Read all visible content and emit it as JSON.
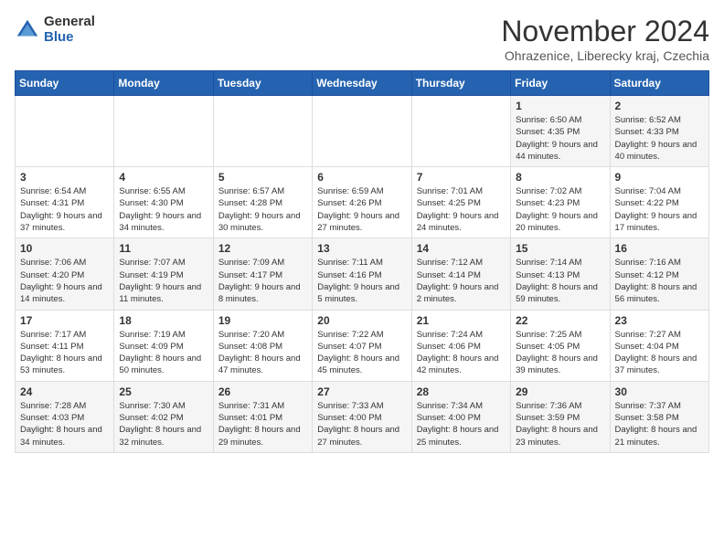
{
  "logo": {
    "general": "General",
    "blue": "Blue"
  },
  "title": "November 2024",
  "subtitle": "Ohrazenice, Liberecky kraj, Czechia",
  "weekdays": [
    "Sunday",
    "Monday",
    "Tuesday",
    "Wednesday",
    "Thursday",
    "Friday",
    "Saturday"
  ],
  "weeks": [
    [
      {
        "num": "",
        "info": ""
      },
      {
        "num": "",
        "info": ""
      },
      {
        "num": "",
        "info": ""
      },
      {
        "num": "",
        "info": ""
      },
      {
        "num": "",
        "info": ""
      },
      {
        "num": "1",
        "info": "Sunrise: 6:50 AM\nSunset: 4:35 PM\nDaylight: 9 hours\nand 44 minutes."
      },
      {
        "num": "2",
        "info": "Sunrise: 6:52 AM\nSunset: 4:33 PM\nDaylight: 9 hours\nand 40 minutes."
      }
    ],
    [
      {
        "num": "3",
        "info": "Sunrise: 6:54 AM\nSunset: 4:31 PM\nDaylight: 9 hours\nand 37 minutes."
      },
      {
        "num": "4",
        "info": "Sunrise: 6:55 AM\nSunset: 4:30 PM\nDaylight: 9 hours\nand 34 minutes."
      },
      {
        "num": "5",
        "info": "Sunrise: 6:57 AM\nSunset: 4:28 PM\nDaylight: 9 hours\nand 30 minutes."
      },
      {
        "num": "6",
        "info": "Sunrise: 6:59 AM\nSunset: 4:26 PM\nDaylight: 9 hours\nand 27 minutes."
      },
      {
        "num": "7",
        "info": "Sunrise: 7:01 AM\nSunset: 4:25 PM\nDaylight: 9 hours\nand 24 minutes."
      },
      {
        "num": "8",
        "info": "Sunrise: 7:02 AM\nSunset: 4:23 PM\nDaylight: 9 hours\nand 20 minutes."
      },
      {
        "num": "9",
        "info": "Sunrise: 7:04 AM\nSunset: 4:22 PM\nDaylight: 9 hours\nand 17 minutes."
      }
    ],
    [
      {
        "num": "10",
        "info": "Sunrise: 7:06 AM\nSunset: 4:20 PM\nDaylight: 9 hours\nand 14 minutes."
      },
      {
        "num": "11",
        "info": "Sunrise: 7:07 AM\nSunset: 4:19 PM\nDaylight: 9 hours\nand 11 minutes."
      },
      {
        "num": "12",
        "info": "Sunrise: 7:09 AM\nSunset: 4:17 PM\nDaylight: 9 hours\nand 8 minutes."
      },
      {
        "num": "13",
        "info": "Sunrise: 7:11 AM\nSunset: 4:16 PM\nDaylight: 9 hours\nand 5 minutes."
      },
      {
        "num": "14",
        "info": "Sunrise: 7:12 AM\nSunset: 4:14 PM\nDaylight: 9 hours\nand 2 minutes."
      },
      {
        "num": "15",
        "info": "Sunrise: 7:14 AM\nSunset: 4:13 PM\nDaylight: 8 hours\nand 59 minutes."
      },
      {
        "num": "16",
        "info": "Sunrise: 7:16 AM\nSunset: 4:12 PM\nDaylight: 8 hours\nand 56 minutes."
      }
    ],
    [
      {
        "num": "17",
        "info": "Sunrise: 7:17 AM\nSunset: 4:11 PM\nDaylight: 8 hours\nand 53 minutes."
      },
      {
        "num": "18",
        "info": "Sunrise: 7:19 AM\nSunset: 4:09 PM\nDaylight: 8 hours\nand 50 minutes."
      },
      {
        "num": "19",
        "info": "Sunrise: 7:20 AM\nSunset: 4:08 PM\nDaylight: 8 hours\nand 47 minutes."
      },
      {
        "num": "20",
        "info": "Sunrise: 7:22 AM\nSunset: 4:07 PM\nDaylight: 8 hours\nand 45 minutes."
      },
      {
        "num": "21",
        "info": "Sunrise: 7:24 AM\nSunset: 4:06 PM\nDaylight: 8 hours\nand 42 minutes."
      },
      {
        "num": "22",
        "info": "Sunrise: 7:25 AM\nSunset: 4:05 PM\nDaylight: 8 hours\nand 39 minutes."
      },
      {
        "num": "23",
        "info": "Sunrise: 7:27 AM\nSunset: 4:04 PM\nDaylight: 8 hours\nand 37 minutes."
      }
    ],
    [
      {
        "num": "24",
        "info": "Sunrise: 7:28 AM\nSunset: 4:03 PM\nDaylight: 8 hours\nand 34 minutes."
      },
      {
        "num": "25",
        "info": "Sunrise: 7:30 AM\nSunset: 4:02 PM\nDaylight: 8 hours\nand 32 minutes."
      },
      {
        "num": "26",
        "info": "Sunrise: 7:31 AM\nSunset: 4:01 PM\nDaylight: 8 hours\nand 29 minutes."
      },
      {
        "num": "27",
        "info": "Sunrise: 7:33 AM\nSunset: 4:00 PM\nDaylight: 8 hours\nand 27 minutes."
      },
      {
        "num": "28",
        "info": "Sunrise: 7:34 AM\nSunset: 4:00 PM\nDaylight: 8 hours\nand 25 minutes."
      },
      {
        "num": "29",
        "info": "Sunrise: 7:36 AM\nSunset: 3:59 PM\nDaylight: 8 hours\nand 23 minutes."
      },
      {
        "num": "30",
        "info": "Sunrise: 7:37 AM\nSunset: 3:58 PM\nDaylight: 8 hours\nand 21 minutes."
      }
    ]
  ]
}
